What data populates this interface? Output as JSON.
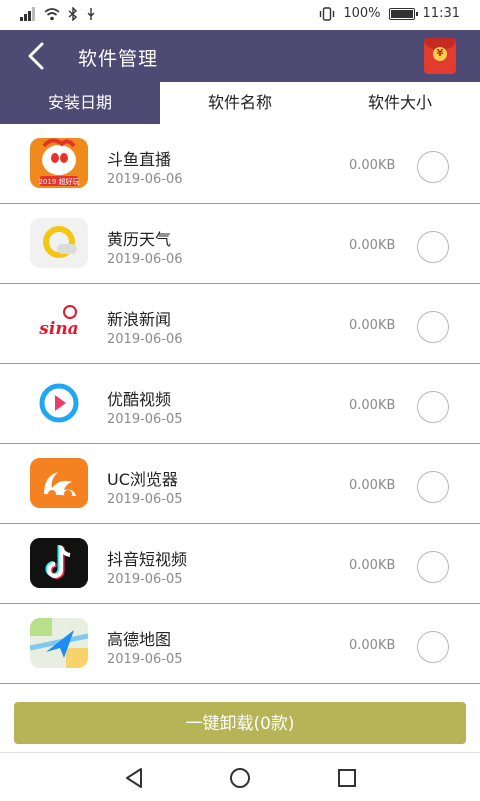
{
  "status_bar": {
    "battery_percent": "100%",
    "battery_level": 1.0,
    "time": "11:31"
  },
  "header": {
    "title": "软件管理",
    "redpacket_symbol": "¥"
  },
  "tabs": [
    {
      "label": "安装日期",
      "active": true
    },
    {
      "label": "软件名称",
      "active": false
    },
    {
      "label": "软件大小",
      "active": false
    }
  ],
  "apps": [
    {
      "name": "斗鱼直播",
      "date": "2019-06-06",
      "size": "0.00KB",
      "icon": "douyu-icon"
    },
    {
      "name": "黄历天气",
      "date": "2019-06-06",
      "size": "0.00KB",
      "icon": "huangli-weather-icon"
    },
    {
      "name": "新浪新闻",
      "date": "2019-06-06",
      "size": "0.00KB",
      "icon": "sina-news-icon"
    },
    {
      "name": "优酷视频",
      "date": "2019-06-05",
      "size": "0.00KB",
      "icon": "youku-icon"
    },
    {
      "name": "UC浏览器",
      "date": "2019-06-05",
      "size": "0.00KB",
      "icon": "uc-browser-icon"
    },
    {
      "name": "抖音短视频",
      "date": "2019-06-05",
      "size": "0.00KB",
      "icon": "douyin-icon"
    },
    {
      "name": "高德地图",
      "date": "2019-06-05",
      "size": "0.00KB",
      "icon": "amap-icon"
    }
  ],
  "icon_text": {
    "douyu_badge": "2019 超好玩",
    "sina_logo": "sina"
  },
  "bottom": {
    "uninstall_label": "一键卸载(0款)"
  },
  "colors": {
    "header_bg": "#4d4a74",
    "uninstall_bg": "#b7b357"
  }
}
